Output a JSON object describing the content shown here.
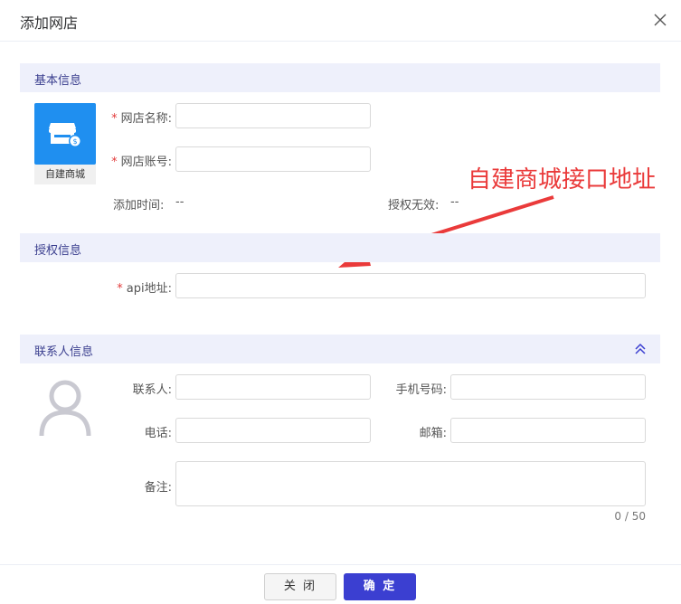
{
  "dialog": {
    "title": "添加网店",
    "close_icon": "close-icon"
  },
  "basic": {
    "section_title": "基本信息",
    "store_type_label": "自建商城",
    "store_name": {
      "label": "网店名称:",
      "value": ""
    },
    "store_account": {
      "label": "网店账号:",
      "value": ""
    },
    "add_time": {
      "label": "添加时间:",
      "value": "--"
    },
    "auth_invalid": {
      "label": "授权无效:",
      "value": "--"
    }
  },
  "auth": {
    "section_title": "授权信息",
    "api": {
      "label": "api地址:",
      "value": ""
    }
  },
  "annotation": {
    "text": "自建商城接口地址",
    "color": "#ea3a3a"
  },
  "contact": {
    "section_title": "联系人信息",
    "contact_person": {
      "label": "联系人:",
      "value": ""
    },
    "mobile": {
      "label": "手机号码:",
      "value": ""
    },
    "phone": {
      "label": "电话:",
      "value": ""
    },
    "email": {
      "label": "邮箱:",
      "value": ""
    },
    "remark": {
      "label": "备注:",
      "value": "",
      "counter": "0 / 50"
    }
  },
  "footer": {
    "cancel_label": "关 闭",
    "ok_label": "确 定"
  },
  "colors": {
    "accent": "#3b3fd1",
    "section_bg": "#eef0fb",
    "store_logo": "#1f8ff0",
    "required": "#e23b3b"
  }
}
